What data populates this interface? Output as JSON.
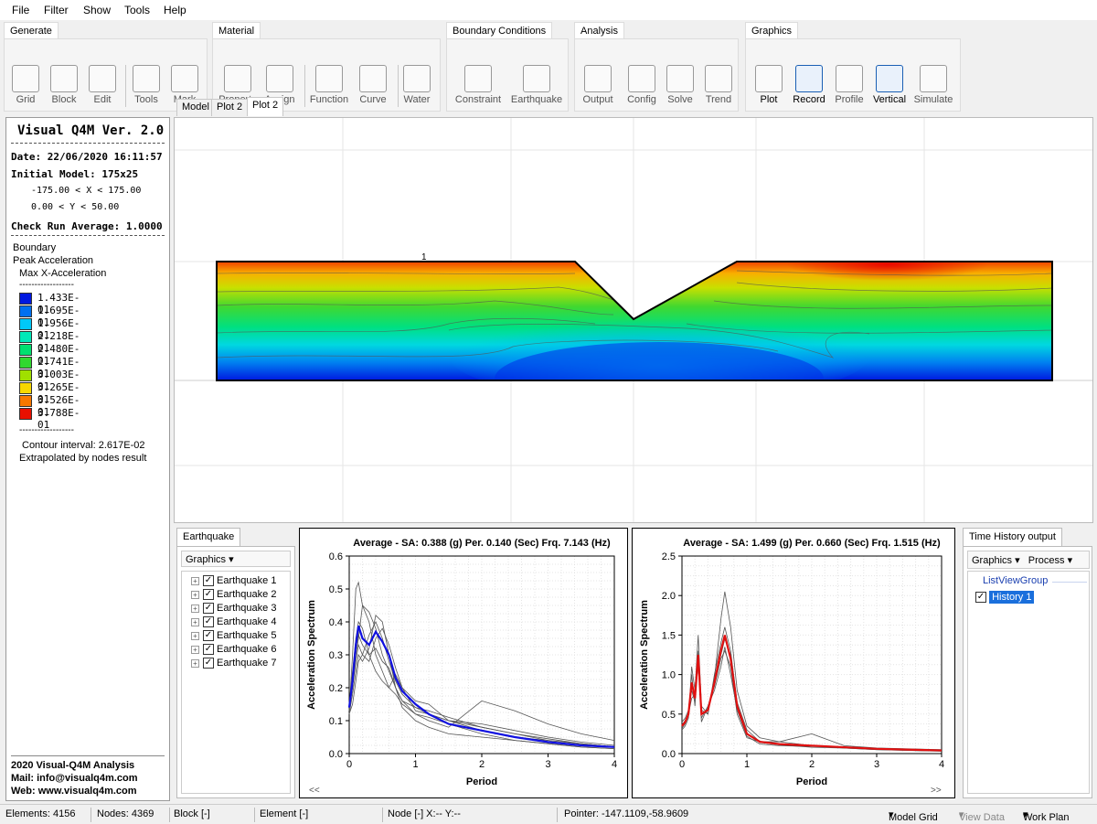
{
  "menu": [
    "File",
    "Filter",
    "Show",
    "Tools",
    "Help"
  ],
  "ribbon": {
    "groups": [
      {
        "name": "Generate",
        "buttons": [
          "Grid",
          "Block",
          "Edit",
          "Tools",
          "Mark"
        ]
      },
      {
        "name": "Material",
        "buttons": [
          "Property",
          "Assign",
          "Function",
          "Curve",
          "Water"
        ]
      },
      {
        "name": "Boundary Conditions",
        "buttons": [
          "Constraint",
          "Earthquake"
        ]
      },
      {
        "name": "Analysis",
        "buttons": [
          "Output",
          "Config",
          "Solve",
          "Trend"
        ]
      },
      {
        "name": "Graphics",
        "buttons": [
          "Plot",
          "Record",
          "Profile",
          "Vertical",
          "Simulate"
        ]
      }
    ]
  },
  "doc_tabs": [
    "Model",
    "Plot 2",
    "Plot 2"
  ],
  "info_panel": {
    "title": "Visual Q4M Ver. 2.0",
    "date": "Date: 22/06/2020 16:11:57",
    "initial_model": "Initial Model: 175x25",
    "x_range": "-175.00 < X < 175.00",
    "y_range": "0.00 < Y < 50.00",
    "check_run": "Check Run Average: 1.0000",
    "boundary": "Boundary",
    "peak": "Peak Acceleration",
    "max_x": "Max X-Acceleration",
    "dashes": "------------------",
    "legend": [
      {
        "value": "1.433E-01",
        "color": "#0018e0"
      },
      {
        "value": "1.695E-01",
        "color": "#0070f0"
      },
      {
        "value": "1.956E-01",
        "color": "#00c8f8"
      },
      {
        "value": "2.218E-01",
        "color": "#00e8b8"
      },
      {
        "value": "2.480E-01",
        "color": "#00e070"
      },
      {
        "value": "2.741E-01",
        "color": "#30d830"
      },
      {
        "value": "3.003E-01",
        "color": "#a0e000"
      },
      {
        "value": "3.265E-01",
        "color": "#f8d800"
      },
      {
        "value": "3.526E-01",
        "color": "#f87800"
      },
      {
        "value": "3.788E-01",
        "color": "#e81000"
      }
    ],
    "contour": "Contour interval: 2.617E-02",
    "extrapolated": "Extrapolated by nodes result",
    "footer_title": "2020 Visual-Q4M Analysis",
    "footer_mail": "Mail: info@visualq4m.com",
    "footer_web": "Web: www.visualq4m.com"
  },
  "model_view": {
    "marker_label": "1"
  },
  "earthquake_panel": {
    "tab": "Earthquake",
    "graphics_menu": "Graphics",
    "items": [
      "Earthquake 1",
      "Earthquake 2",
      "Earthquake 3",
      "Earthquake 4",
      "Earthquake 5",
      "Earthquake 6",
      "Earthquake 7"
    ]
  },
  "history_panel": {
    "tab": "Time History output",
    "graphics_menu": "Graphics",
    "process_menu": "Process",
    "group": "ListViewGroup",
    "item": "History 1"
  },
  "chart_data": [
    {
      "type": "line",
      "title": "Average - SA: 0.388 (g) Per. 0.140 (Sec) Frq. 7.143 (Hz)",
      "xlabel": "Period",
      "ylabel": "Acceleration Spectrum",
      "xlim": [
        0,
        4
      ],
      "ylim": [
        0,
        0.6
      ],
      "xticks": [
        "0",
        "1",
        "2",
        "3",
        "4"
      ],
      "yticks": [
        "0.0",
        "0.1",
        "0.2",
        "0.3",
        "0.4",
        "0.5",
        "0.6"
      ],
      "grid": true,
      "nav_label": "<<",
      "average_color": "#1010e0",
      "x": [
        0,
        0.05,
        0.1,
        0.14,
        0.2,
        0.3,
        0.4,
        0.5,
        0.6,
        0.7,
        0.8,
        1.0,
        1.2,
        1.5,
        2.0,
        2.5,
        3.0,
        3.5,
        4.0
      ],
      "average": [
        0.14,
        0.22,
        0.33,
        0.388,
        0.35,
        0.33,
        0.37,
        0.34,
        0.3,
        0.23,
        0.19,
        0.15,
        0.12,
        0.09,
        0.07,
        0.05,
        0.035,
        0.025,
        0.02
      ],
      "records": [
        [
          0.13,
          0.3,
          0.5,
          0.52,
          0.45,
          0.4,
          0.3,
          0.25,
          0.2,
          0.18,
          0.15,
          0.12,
          0.11,
          0.09,
          0.06,
          0.04,
          0.03,
          0.02,
          0.015
        ],
        [
          0.14,
          0.2,
          0.3,
          0.35,
          0.45,
          0.43,
          0.38,
          0.3,
          0.25,
          0.2,
          0.16,
          0.12,
          0.1,
          0.08,
          0.16,
          0.13,
          0.09,
          0.06,
          0.04
        ],
        [
          0.12,
          0.18,
          0.25,
          0.3,
          0.28,
          0.32,
          0.42,
          0.4,
          0.3,
          0.2,
          0.14,
          0.1,
          0.08,
          0.06,
          0.05,
          0.04,
          0.03,
          0.02,
          0.015
        ],
        [
          0.15,
          0.25,
          0.35,
          0.4,
          0.38,
          0.3,
          0.25,
          0.22,
          0.2,
          0.24,
          0.2,
          0.16,
          0.15,
          0.1,
          0.07,
          0.05,
          0.04,
          0.03,
          0.02
        ],
        [
          0.13,
          0.2,
          0.28,
          0.33,
          0.3,
          0.28,
          0.35,
          0.38,
          0.33,
          0.26,
          0.2,
          0.13,
          0.12,
          0.1,
          0.08,
          0.06,
          0.045,
          0.03,
          0.02
        ],
        [
          0.12,
          0.15,
          0.22,
          0.28,
          0.3,
          0.36,
          0.4,
          0.35,
          0.28,
          0.22,
          0.18,
          0.14,
          0.12,
          0.1,
          0.09,
          0.07,
          0.05,
          0.035,
          0.025
        ],
        [
          0.14,
          0.22,
          0.32,
          0.36,
          0.33,
          0.3,
          0.32,
          0.28,
          0.26,
          0.2,
          0.16,
          0.14,
          0.13,
          0.11,
          0.08,
          0.06,
          0.04,
          0.03,
          0.02
        ]
      ]
    },
    {
      "type": "line",
      "title": "Average - SA: 1.499 (g) Per. 0.660 (Sec) Frq. 1.515 (Hz)",
      "xlabel": "Period",
      "ylabel": "Acceleration Spectrum",
      "xlim": [
        0,
        4
      ],
      "ylim": [
        0,
        2.5
      ],
      "xticks": [
        "0",
        "1",
        "2",
        "3",
        "4"
      ],
      "yticks": [
        "0.0",
        "0.5",
        "1.0",
        "1.5",
        "2.0",
        "2.5"
      ],
      "grid": true,
      "nav_label": ">>",
      "average_color": "#e01010",
      "x": [
        0,
        0.05,
        0.1,
        0.15,
        0.2,
        0.25,
        0.3,
        0.4,
        0.5,
        0.6,
        0.66,
        0.75,
        0.85,
        1.0,
        1.2,
        1.5,
        2.0,
        2.5,
        3.0,
        4.0
      ],
      "average": [
        0.35,
        0.4,
        0.5,
        0.9,
        0.7,
        1.25,
        0.5,
        0.55,
        0.9,
        1.3,
        1.499,
        1.2,
        0.6,
        0.25,
        0.15,
        0.12,
        0.1,
        0.08,
        0.06,
        0.04
      ],
      "records": [
        [
          0.3,
          0.35,
          0.45,
          1.1,
          0.8,
          1.5,
          0.6,
          0.5,
          0.95,
          1.7,
          2.05,
          1.6,
          0.8,
          0.35,
          0.2,
          0.15,
          0.1,
          0.08,
          0.06,
          0.04
        ],
        [
          0.4,
          0.45,
          0.55,
          0.8,
          0.65,
          1.2,
          0.45,
          0.6,
          0.85,
          1.2,
          1.3,
          1.1,
          0.5,
          0.2,
          0.15,
          0.15,
          0.25,
          0.1,
          0.07,
          0.05
        ],
        [
          0.32,
          0.38,
          0.5,
          0.7,
          0.75,
          1.1,
          0.55,
          0.5,
          1.0,
          1.4,
          1.6,
          1.3,
          0.65,
          0.3,
          0.15,
          0.12,
          0.1,
          0.07,
          0.05,
          0.03
        ],
        [
          0.36,
          0.42,
          0.48,
          1.0,
          0.6,
          1.3,
          0.4,
          0.6,
          0.8,
          1.1,
          1.35,
          1.0,
          0.55,
          0.22,
          0.12,
          0.1,
          0.09,
          0.08,
          0.06,
          0.04
        ],
        [
          0.34,
          0.4,
          0.52,
          0.9,
          0.7,
          1.15,
          0.5,
          0.55,
          0.9,
          1.25,
          1.45,
          1.25,
          0.6,
          0.25,
          0.14,
          0.11,
          0.08,
          0.07,
          0.05,
          0.03
        ]
      ]
    }
  ],
  "status": {
    "elements": "Elements: 4156",
    "nodes": "Nodes: 4369",
    "block": "Block [-]",
    "element": "Element [-]",
    "node": "Node [-] X:-- Y:--",
    "pointer": "Pointer: -147.1109,-58.9609",
    "model_grid": "Model Grid",
    "view_data": "View Data",
    "work_plan": "Work Plan"
  }
}
